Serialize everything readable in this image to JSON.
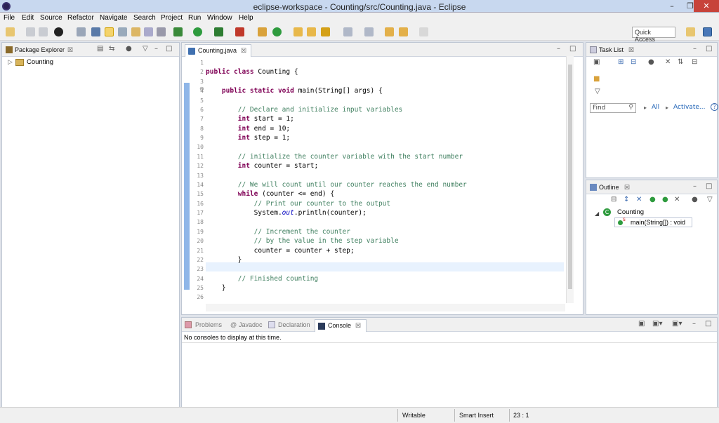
{
  "window": {
    "title": "eclipse-workspace - Counting/src/Counting.java - Eclipse",
    "min_glyph": "–",
    "max_glyph": "❐",
    "close_glyph": "✕"
  },
  "menu": [
    "File",
    "Edit",
    "Source",
    "Refactor",
    "Navigate",
    "Search",
    "Project",
    "Run",
    "Window",
    "Help"
  ],
  "toolbar": {
    "quick_access_label": "Quick Access"
  },
  "package_explorer": {
    "title": "Package Explorer",
    "close_glyph": "☒",
    "tree_item": "Counting"
  },
  "editor": {
    "tab_label": "Counting.java",
    "close_glyph": "☒",
    "line_numbers": [
      "1",
      "2",
      "3",
      "4",
      "5",
      "6",
      "7",
      "8",
      "9",
      "10",
      "11",
      "12",
      "13",
      "14",
      "15",
      "16",
      "17",
      "18",
      "19",
      "20",
      "21",
      "22",
      "23",
      "24",
      "25",
      "26"
    ],
    "current_line": 23
  },
  "task_list": {
    "title": "Task List",
    "close_glyph": "☒",
    "find_placeholder": "Find",
    "filter_all": "All",
    "filter_activate": "Activate...",
    "help_glyph": "?"
  },
  "outline": {
    "title": "Outline",
    "close_glyph": "☒",
    "class_name": "Counting",
    "method_sig": "main(String[]) : void",
    "static_marker": "S"
  },
  "bottom": {
    "tabs": [
      "Problems",
      "Javadoc",
      "Declaration",
      "Console"
    ],
    "active_tab": "Console",
    "close_glyph": "☒",
    "message": "No consoles to display at this time."
  },
  "status": {
    "writable": "Writable",
    "insert_mode": "Smart Insert",
    "position": "23 : 1"
  },
  "colors": {
    "keyword": "#7f0055",
    "comment": "#3f7f5f",
    "field": "#0000c0",
    "current_line": "#e8f2fe",
    "close_button": "#c7433a"
  }
}
